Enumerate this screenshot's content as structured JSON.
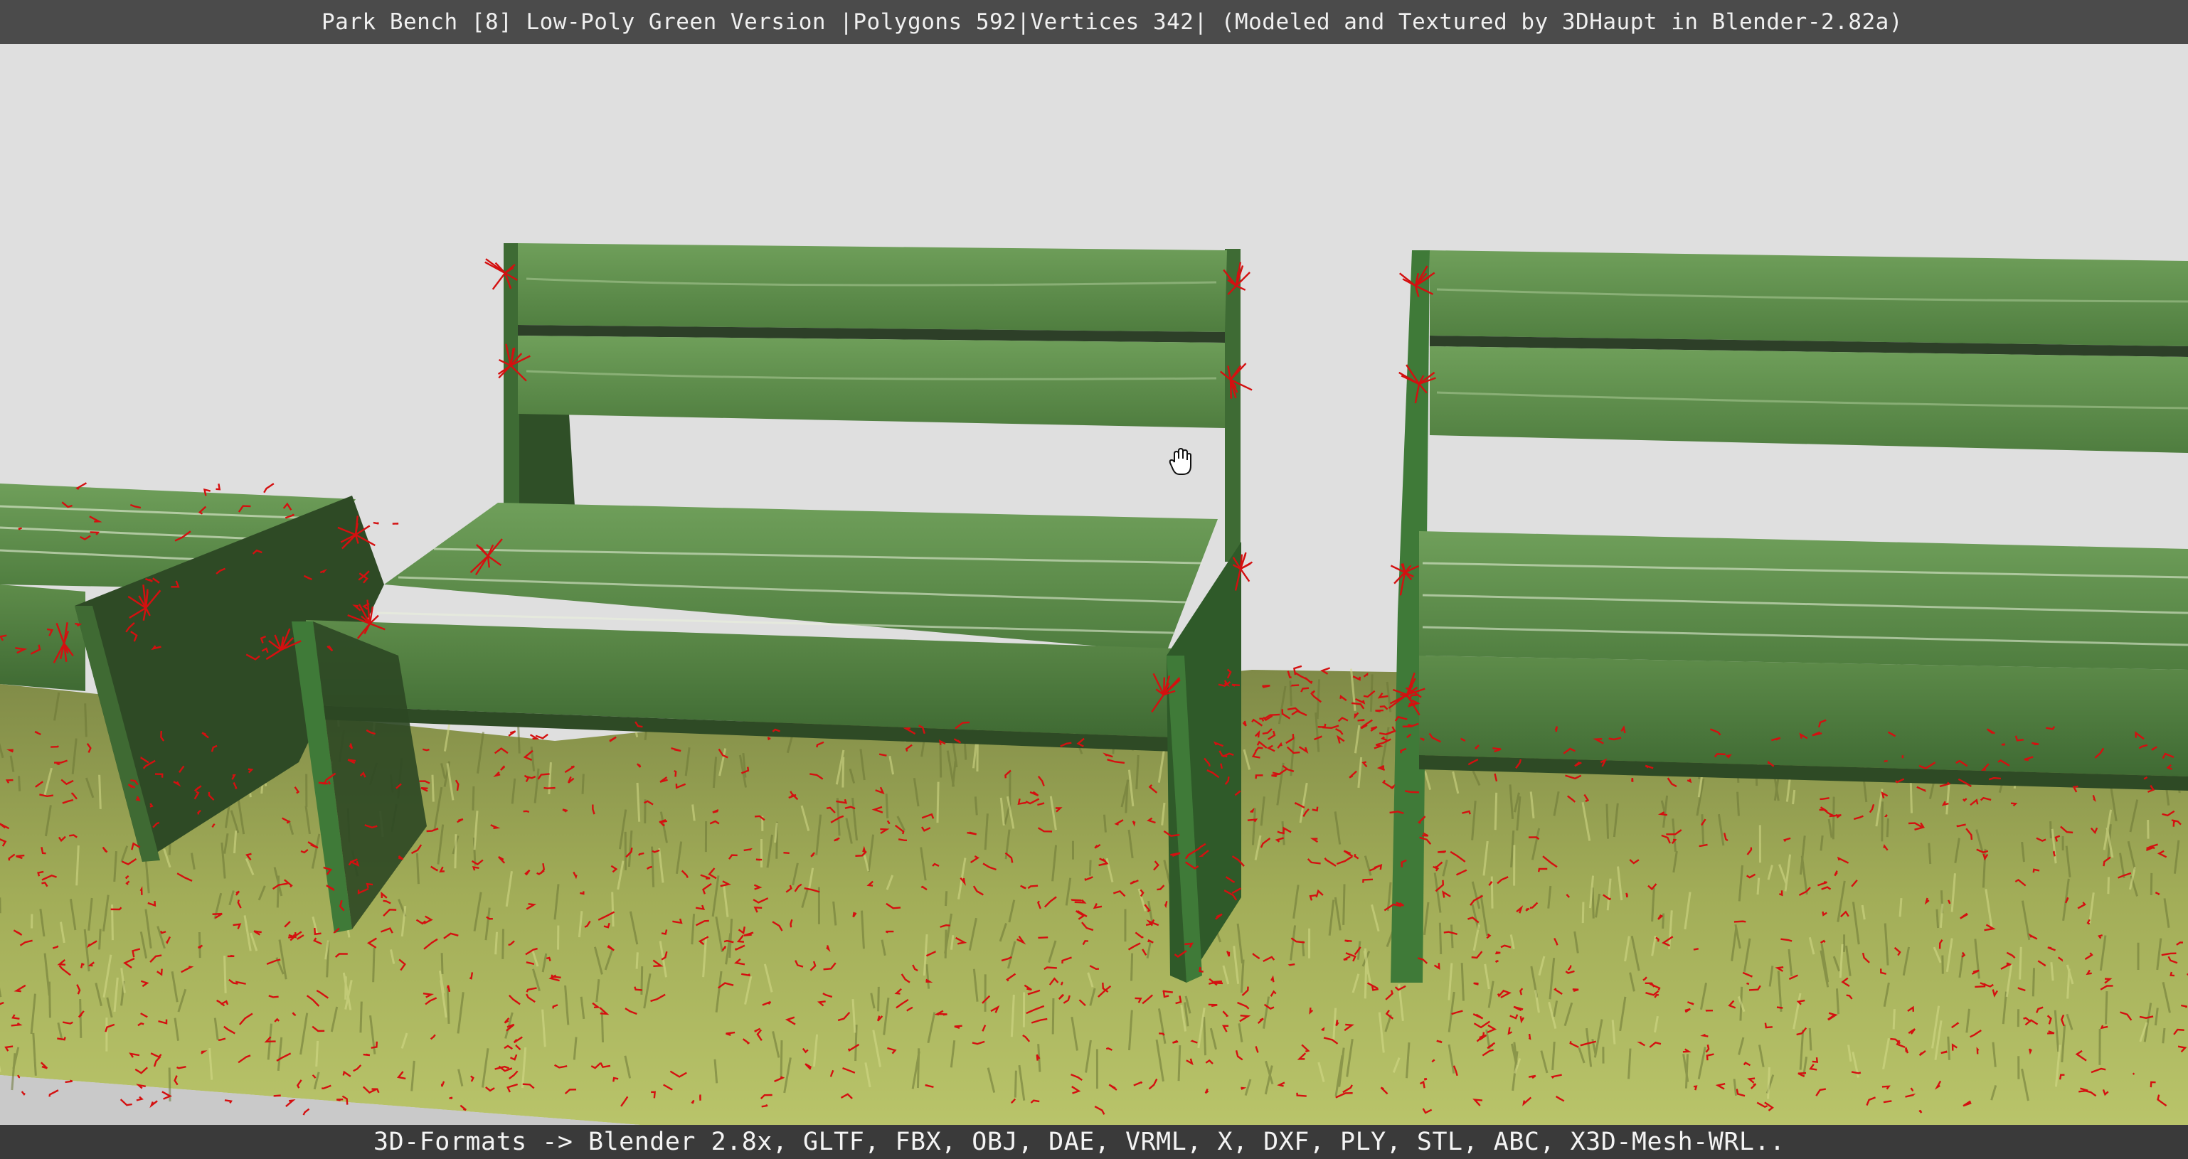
{
  "header": {
    "title": "Park Bench [8] Low-Poly Green Version |Polygons 592|Vertices 342| (Modeled and Textured by 3DHaupt in Blender-2.82a)"
  },
  "footer": {
    "formats": "3D-Formats -> Blender 2.8x, GLTF, FBX, OBJ, DAE, VRML, X, DXF, PLY, STL, ABC, X3D-Mesh-WRL.."
  },
  "scene": {
    "bench_color": "#5f8f4c",
    "bench_side_color": "#2f4f27",
    "grass_color": "#9aa84f",
    "hair_marks_color": "#d41010",
    "background_color": "#dedede",
    "cursor_icon": "hand-grab-icon"
  }
}
